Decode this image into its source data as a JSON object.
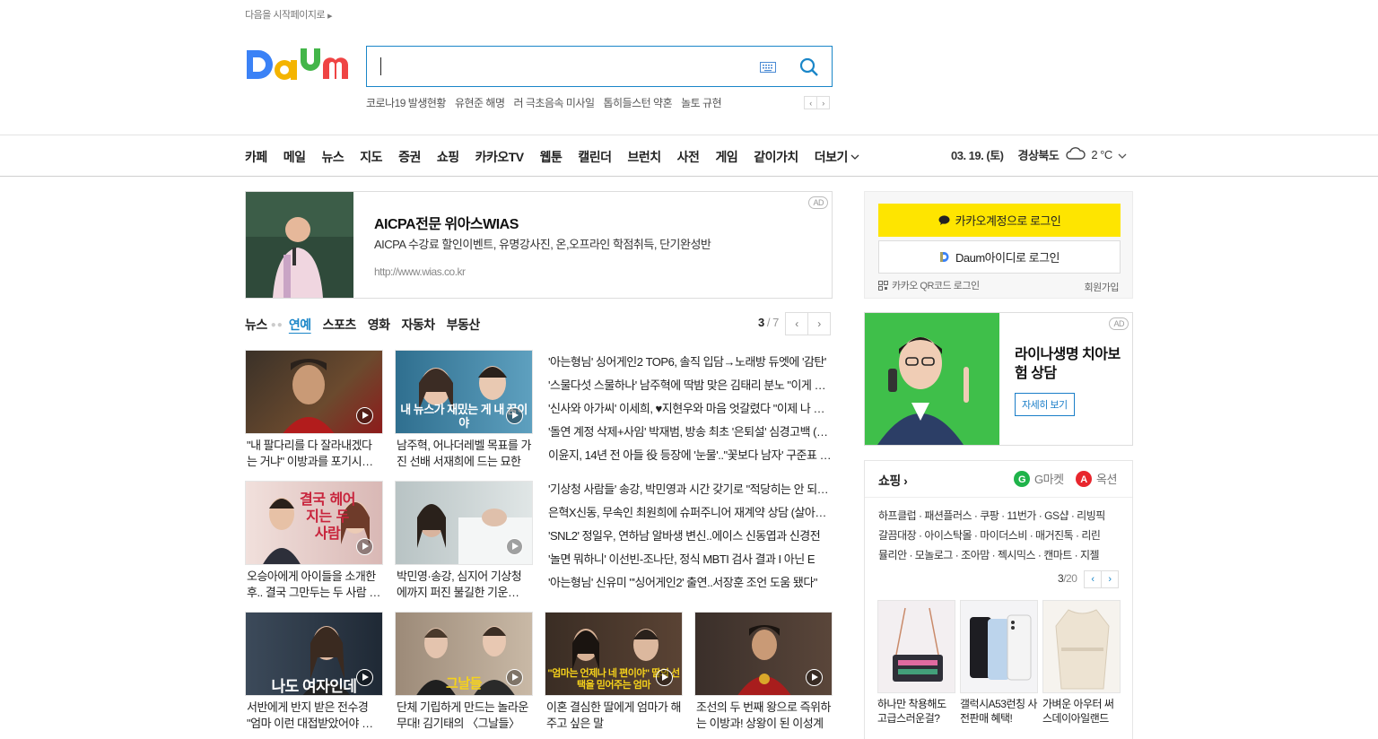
{
  "top": {
    "startpage_link": "다음을 시작페이지로"
  },
  "logo": {
    "alt": "Daum"
  },
  "search": {
    "value": ""
  },
  "hot_keywords": [
    "코로나19 발생현황",
    "유현준 해명",
    "러 극초음속 미사일",
    "톱히들스턴 약혼",
    "놀토 규현"
  ],
  "gnb": {
    "items": [
      "카페",
      "메일",
      "뉴스",
      "지도",
      "증권",
      "쇼핑",
      "카카오TV",
      "웹툰",
      "캘린더",
      "브런치",
      "사전",
      "게임",
      "같이가치"
    ],
    "more": "더보기",
    "date": "03. 19. (토)",
    "location": "경상북도",
    "temperature": "2 °C"
  },
  "ad_top": {
    "badge": "AD",
    "title": "AICPA전문 위아스WIAS",
    "desc": "AICPA 수강료 할인이벤트, 유명강사진, 온,오프라인 학점취득, 단기완성반",
    "url": "http://www.wias.co.kr"
  },
  "news_tabs": {
    "first": "뉴스",
    "tabs": [
      "연예",
      "스포츠",
      "영화",
      "자동차",
      "부동산"
    ],
    "active": "연예",
    "page_current": "3",
    "page_total": "/ 7"
  },
  "cards": [
    {
      "caption": "\"내 팔다리를 다 잘라내겠다는 거냐\" 이방과를 포기시키는",
      "overlay": ""
    },
    {
      "caption": "남주혁, 어나더레벨 목표를 가진 선배 서재희에 드는 묘한",
      "overlay": "내 뉴스가 재밌는 게 내 꿈이야"
    },
    {
      "caption": "오승아에게 아이들을 소개한 후.. 결국 그만두는 두 사람 윤선우",
      "overlay": "결국 헤어지는 두 사람"
    },
    {
      "caption": "박민영·송강, 심지어 기상청에까지 퍼진 불길한 기운 (feat.",
      "overlay": ""
    },
    {
      "caption": "서반에게 반지 받은 전수경 \"엄마 이런 대접받았어야 했어\"",
      "overlay": "나도 여자인데"
    },
    {
      "caption": "단체 기립하게 만드는 놀라운 무대! 김기태의 〈그날들〉",
      "overlay": "그날들"
    },
    {
      "caption": "이혼 결심한 딸에게 엄마가 해주고 싶은 말",
      "overlay": "\"엄마는 언제나 네 편이야\" 딸의 선택을 믿어주는 엄마"
    },
    {
      "caption": "조선의 두 번째 왕으로 즉위하는 이방과! 상왕이 된 이성계",
      "overlay": ""
    }
  ],
  "headlines_1": [
    "'아는형님' 싱어게인2 TOP6, 솔직 입담→노래방 듀엣에 '감탄'",
    "'스물다섯 스물하나' 남주혁에 딱밤 맞은 김태리 분노 \"이게 뭐야\"",
    "'신사와 아가씨' 이세희, ♥지현우와 마음 엇갈렸다 \"이제 나 좋아해?\"",
    "'돌연 계정 삭제+사임' 박재범, 방송 최초 '은퇴설' 심경고백 (종합)",
    "이윤지, 14년 전 아들 役 등장에 '눈물'..\"꽃보다 남자' 구준표 동생\""
  ],
  "headlines_2": [
    "'기상청 사람들' 송강, 박민영과 시간 갖기로 \"적당히는 안 되겠다\"",
    "은혁X신동, 무속인 최원희에 슈퍼주니어 재계약 상담 (살아보니)",
    "'SNL2' 정일우, 연하남 알바생 변신..에이스 신동엽과 신경전",
    "'놀면 뭐하니' 이선빈-조나단, 정식 MBTI 검사 결과 I 아닌 E",
    "'아는형님' 신유미 \"'싱어게인2' 출연..서장훈 조언 도움 됐다\""
  ],
  "login": {
    "kakao": "카카오계정으로 로그인",
    "daum": "Daum아이디로 로그인",
    "qr": "카카오 QR코드 로그인",
    "join": "회원가입"
  },
  "ad_side": {
    "badge": "AD",
    "title": "라이나생명 치아보험 상담",
    "button": "자세히 보기"
  },
  "shopping": {
    "title": "쇼핑",
    "gmarket": "G마켓",
    "auction": "옥션",
    "brands": [
      "하프클럽 · 패션플러스 · 쿠팡 · 11번가 · GS샵 · 리빙픽",
      "갈끔대장 · 아이스탁몰 · 마이더스비 · 매거진톡 · 리린",
      "뮬리안 · 모놀로그 · 조아맘 · 젝시믹스 · 캔마트 · 지젤"
    ],
    "page_current": "3",
    "page_total": "/20",
    "products": [
      {
        "caption": "하나만 착용해도 고급스러운걸?"
      },
      {
        "caption": "갤럭시A53런칭 사전판매 혜택!"
      },
      {
        "caption": "가벼운 아우터 써스데이아일랜드"
      }
    ]
  },
  "colors": {
    "accent": "#1a86c8",
    "kakao_yellow": "#fee500",
    "ad_green": "#3fbf4a"
  }
}
